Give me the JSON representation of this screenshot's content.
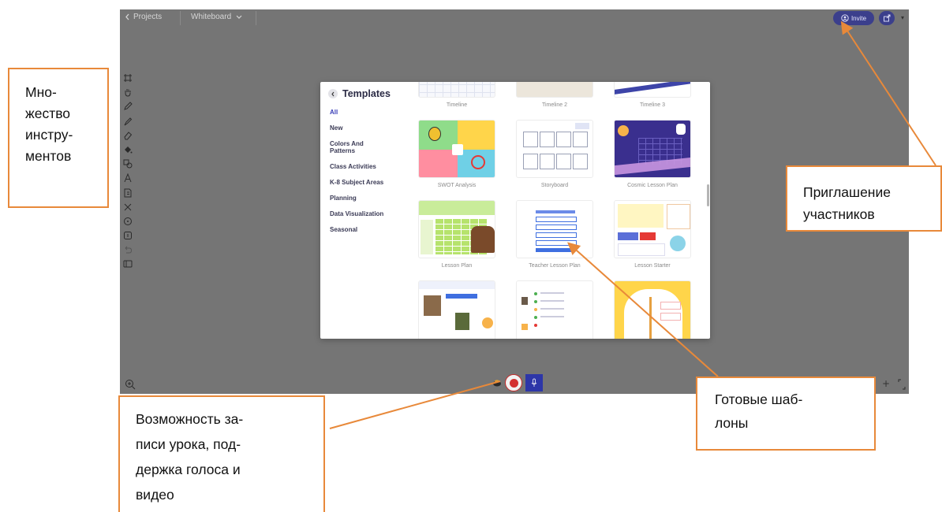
{
  "colors": {
    "canvas": "#757575",
    "accent": "#3b3f8c",
    "active_category": "#3a3fb8",
    "callout_border": "#e8893a",
    "record_red": "#d32f2f"
  },
  "topbar": {
    "back_label": "Projects",
    "board_label": "Whiteboard",
    "invite_label": "Invite"
  },
  "toolbar": {
    "tools": [
      "select-icon",
      "hand-icon",
      "pencil-icon",
      "marker-icon",
      "eraser-icon",
      "fill-icon",
      "shapes-icon",
      "text-icon",
      "sticky-note-icon",
      "close-icon",
      "timer-icon",
      "frame-icon",
      "undo-icon",
      "panel-icon"
    ]
  },
  "modal": {
    "title": "Templates",
    "categories": [
      {
        "label": "All",
        "active": true
      },
      {
        "label": "New",
        "active": false
      },
      {
        "label": "Colors And Patterns",
        "active": false
      },
      {
        "label": "Class Activities",
        "active": false
      },
      {
        "label": "K-8 Subject Areas",
        "active": false
      },
      {
        "label": "Planning",
        "active": false
      },
      {
        "label": "Data Visualization",
        "active": false
      },
      {
        "label": "Seasonal",
        "active": false
      }
    ],
    "templates": [
      {
        "caption": "Timeline"
      },
      {
        "caption": "Timeline 2"
      },
      {
        "caption": "Timeline 3"
      },
      {
        "caption": "SWOT Analysis"
      },
      {
        "caption": "Storyboard"
      },
      {
        "caption": "Cosmic Lesson Plan"
      },
      {
        "caption": "Lesson Plan"
      },
      {
        "caption": "Teacher Lesson Plan"
      },
      {
        "caption": "Lesson Starter"
      },
      {
        "caption": ""
      },
      {
        "caption": ""
      },
      {
        "caption": ""
      }
    ]
  },
  "callouts": {
    "tools": [
      "Мно-",
      "жество",
      "инстру-",
      "ментов"
    ],
    "invite": [
      "Приглашение",
      "участников"
    ],
    "templates": [
      "Готовые шаб-",
      "лоны"
    ],
    "recording": [
      "Возможность за-",
      "писи урока, под-",
      "держка голоса и",
      "видео"
    ]
  }
}
